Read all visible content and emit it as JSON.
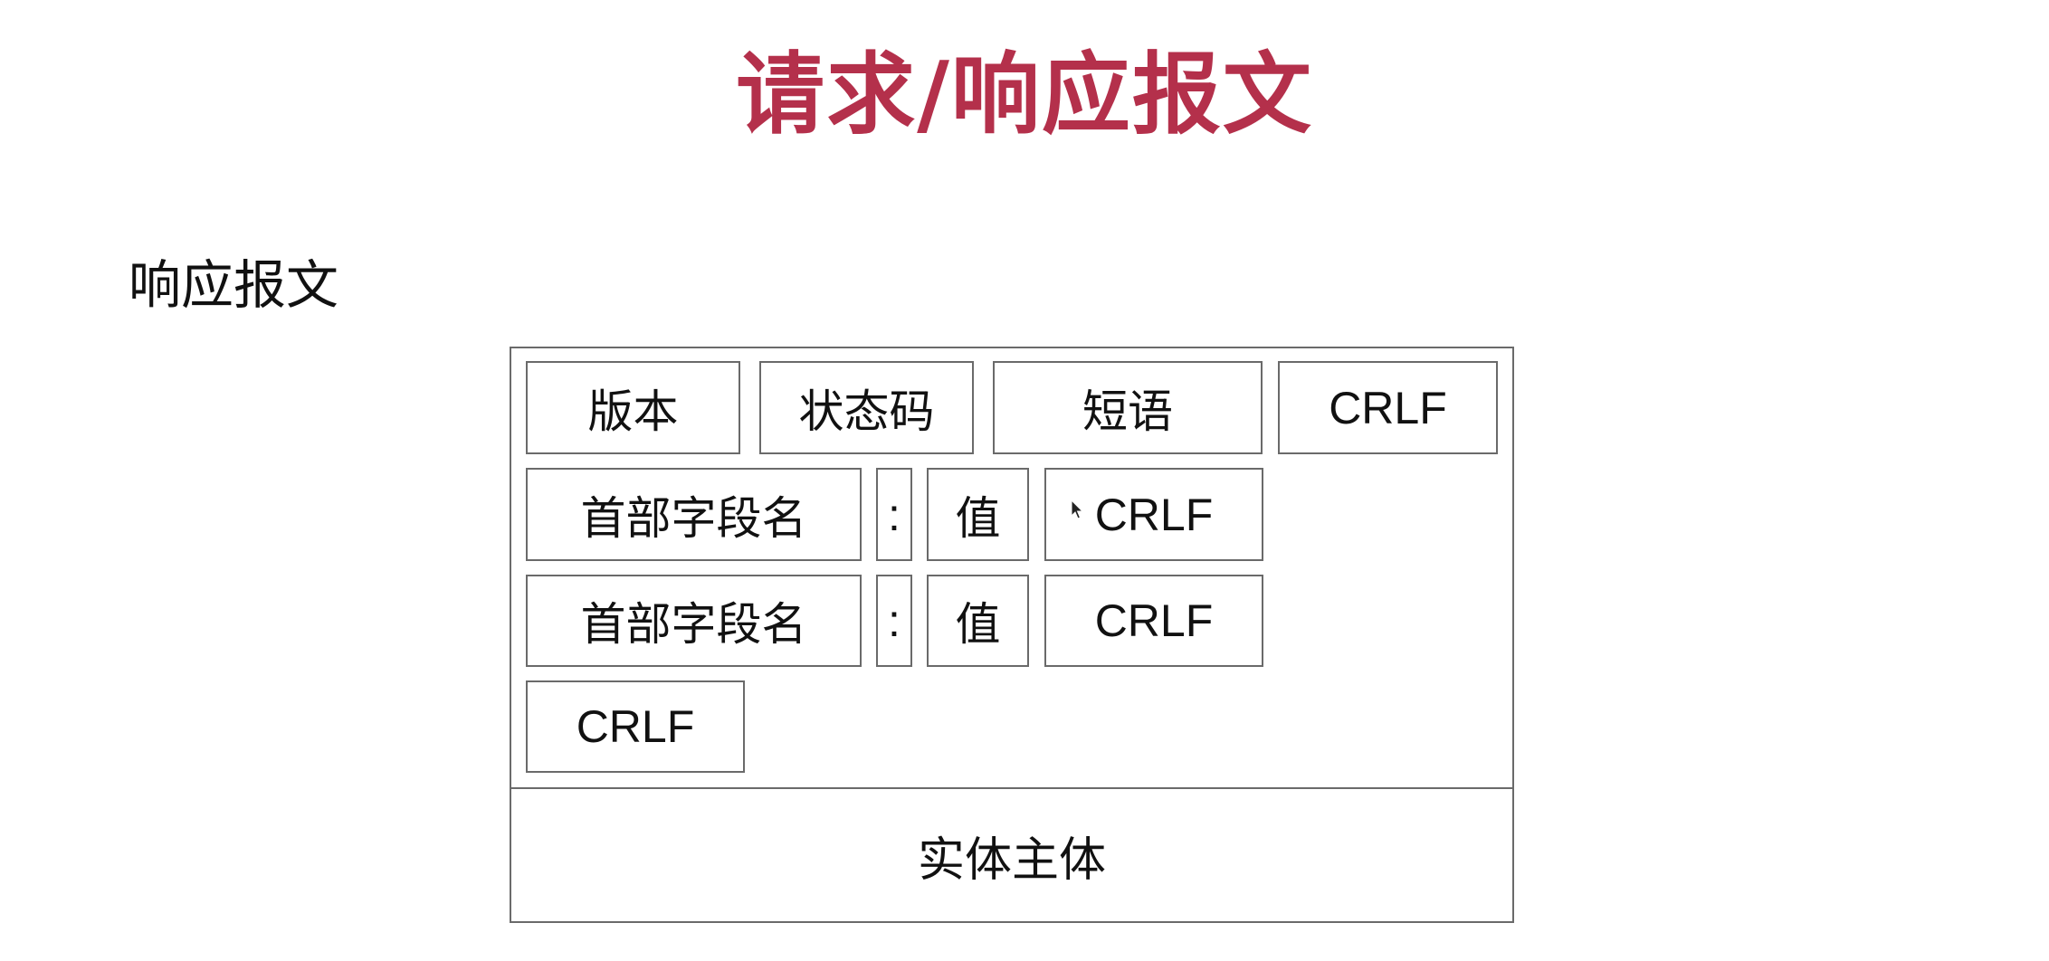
{
  "slide": {
    "title": "请求/响应报文",
    "section_label": "响应报文"
  },
  "diagram": {
    "status_line": {
      "version": "版本",
      "status_code": "状态码",
      "phrase": "短语",
      "crlf": "CRLF"
    },
    "header_rows": [
      {
        "field_name": "首部字段名",
        "colon": ":",
        "value": "值",
        "crlf": "CRLF"
      },
      {
        "field_name": "首部字段名",
        "colon": ":",
        "value": "值",
        "crlf": "CRLF"
      }
    ],
    "blank_line_crlf": "CRLF",
    "entity_body": "实体主体"
  },
  "colors": {
    "title": "#b4304b",
    "border": "#6a6a6a"
  }
}
